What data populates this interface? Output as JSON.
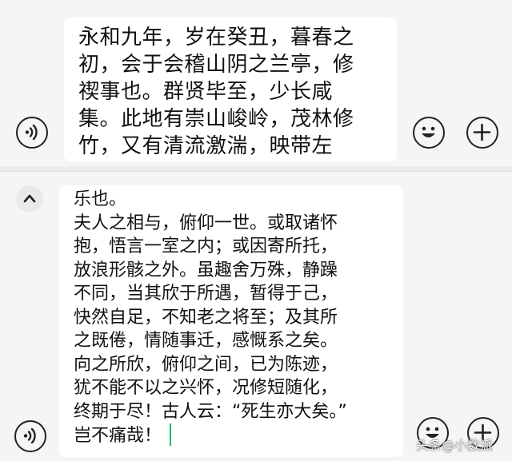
{
  "top_panel": {
    "lines": [
      "永和九年，岁在癸丑，暮春之",
      "初，会于会稽山阴之兰亭，修",
      "禊事也。群贤毕至，少长咸",
      "集。此地有崇山峻岭，茂林修",
      "竹，又有清流激湍，映带左"
    ]
  },
  "bottom_panel": {
    "lines": [
      "乐也。",
      "夫人之相与，俯仰一世。或取诸怀",
      "抱，悟言一室之内；或因寄所托，",
      "放浪形骸之外。虽趣舍万殊，静躁",
      "不同，当其欣于所遇，暂得于己，",
      "快然自足，不知老之将至；及其所",
      "之既倦，情随事迁，感慨系之矣。",
      "向之所欣，俯仰之间，已为陈迹，",
      "犹不能不以之兴怀，况修短随化，",
      "终期于尽！古人云：“死生亦大矣。”",
      "岂不痛哉！"
    ]
  },
  "watermark": "头条@小数派",
  "icons": {
    "voice": "voice-icon",
    "emoji": "emoji-icon",
    "plus": "plus-icon",
    "collapse": "chevron-up-icon"
  },
  "colors": {
    "cursor": "#07c160",
    "background": "#f5f5f5",
    "input_bg": "#ffffff"
  }
}
